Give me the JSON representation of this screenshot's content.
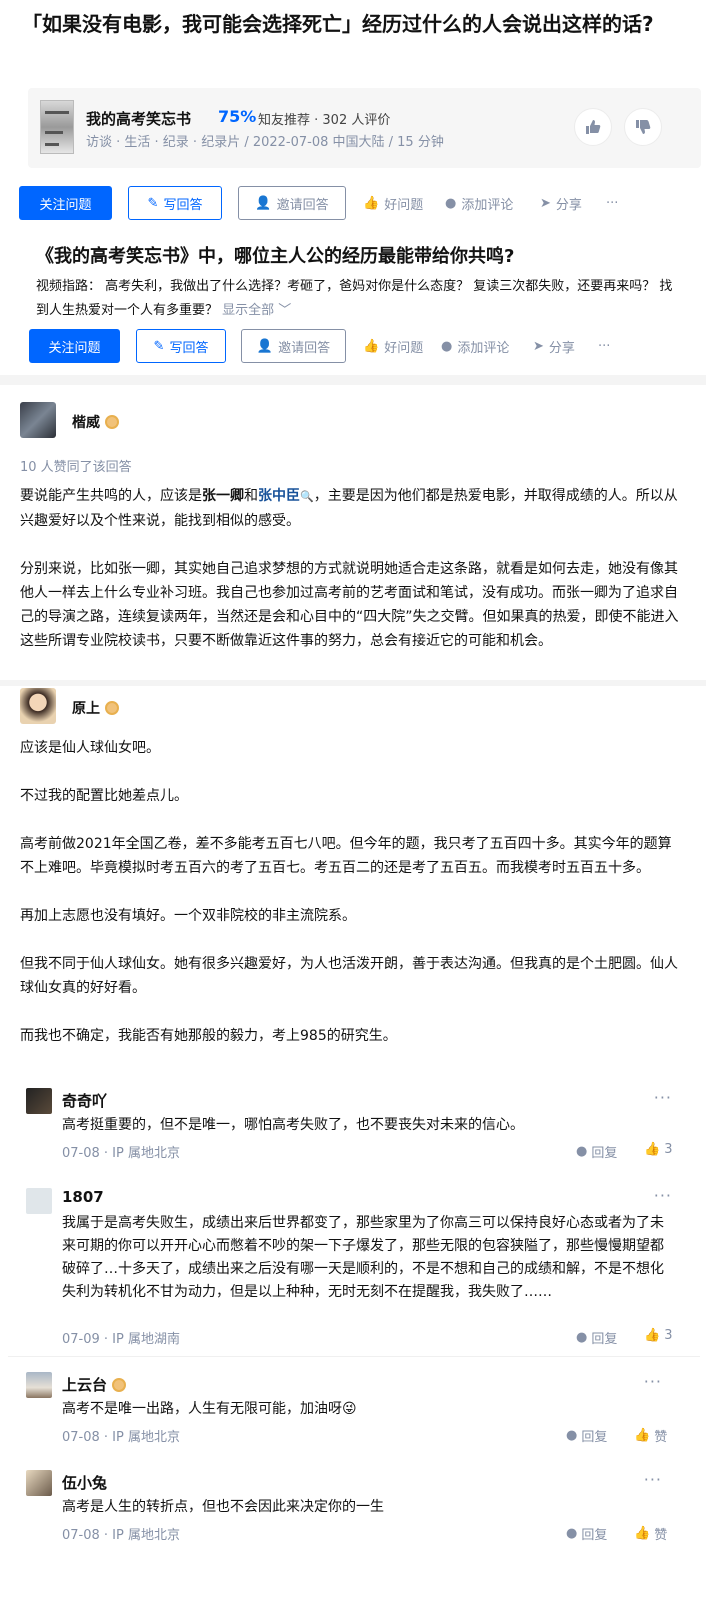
{
  "question": {
    "title": "「如果没有电影，我可能会选择死亡」经历过什么的人会说出这样的话?"
  },
  "media": {
    "name": "我的高考笑忘书",
    "score": "75%",
    "recommend": "知友推荐 · 302 人评价",
    "meta": "访谈 · 生活 · 纪录 · 纪录片 / 2022-07-08 中国大陆 / 15 分钟"
  },
  "actions": {
    "follow": "关注问题",
    "write": "写回答",
    "invite": "邀请回答",
    "good": "好问题",
    "comment": "添加评论",
    "share": "分享",
    "more": "···"
  },
  "question2": {
    "title": "《我的高考笑忘书》中，哪位主人公的经历最能带给你共鸣?",
    "desc": "视频指路： 高考失利，我做出了什么选择？考砸了，爸妈对你是什么态度？ 复读三次都失败，还要再来吗？ 找到人生热爱对一个人有多重要？",
    "show_all": "显示全部 ﹀"
  },
  "answer1": {
    "author": "楷威",
    "likes_note": "10 人赞同了该回答",
    "p1_a": "要说能产生共鸣的人，应该是",
    "p1_kw1": "张一卿",
    "p1_and": "和",
    "p1_kw2": "张中臣",
    "p1_b": "，主要是因为他们都是热爱电影，并取得成绩的人。所以从兴趣爱好以及个性来说，能找到相似的感受。",
    "p2": "分别来说，比如张一卿，其实她自己追求梦想的方式就说明她适合走这条路，就看是如何去走，她没有像其他人一样去上什么专业补习班。我自己也参加过高考前的艺考面试和笔试，没有成功。而张一卿为了追求自己的导演之路，连续复读两年，当然还是会和心目中的“四大院”失之交臂。但如果真的热爱，即使不能进入这些所谓专业院校读书，只要不断做靠近这件事的努力，总会有接近它的可能和机会。"
  },
  "answer2": {
    "author": "原上",
    "paragraphs": [
      "应该是仙人球仙女吧。",
      "不过我的配置比她差点儿。",
      "高考前做2021年全国乙卷，差不多能考五百七八吧。但今年的题，我只考了五百四十多。其实今年的题算不上难吧。毕竟模拟时考五百六的考了五百七。考五百二的还是考了五百五。而我模考时五百五十多。",
      "再加上志愿也没有填好。一个双非院校的非主流院系。",
      "但我不同于仙人球仙女。她有很多兴趣爱好，为人也活泼开朗，善于表达沟通。但我真的是个土肥圆。仙人球仙女真的好好看。",
      "而我也不确定，我能否有她那般的毅力，考上985的研究生。"
    ]
  },
  "comments": [
    {
      "name": "奇奇吖",
      "text": "高考挺重要的，但不是唯一，哪怕高考失败了，也不要丧失对未来的信心。",
      "meta": "07-08 · IP 属地北京",
      "reply": "回复",
      "likes": "3"
    },
    {
      "name": "1807",
      "text": "我属于是高考失败生，成绩出来后世界都变了，那些家里为了你高三可以保持良好心态或者为了未来可期的你可以开开心心而憋着不吵的架一下子爆发了，那些无限的包容狭隘了，那些慢慢期望都破碎了…十多天了，成绩出来之后没有哪一天是顺利的，不是不想和自己的成绩和解，不是不想化失利为转机化不甘为动力，但是以上种种，无时无刻不在提醒我，我失败了……",
      "meta": "07-09 · IP 属地湖南",
      "reply": "回复",
      "likes": "3"
    },
    {
      "name": "上云台",
      "text": "高考不是唯一出路，人生有无限可能，加油呀😜",
      "meta": "07-08 · IP 属地北京",
      "reply": "回复",
      "likes": "赞"
    },
    {
      "name": "伍小兔",
      "text": "高考是人生的转折点，但也不会因此来决定你的一生",
      "meta": "07-08 · IP 属地北京",
      "reply": "回复",
      "likes": "赞"
    }
  ],
  "colors": {
    "brand": "#0066ff",
    "meta": "#8590a6",
    "text": "#121212"
  }
}
